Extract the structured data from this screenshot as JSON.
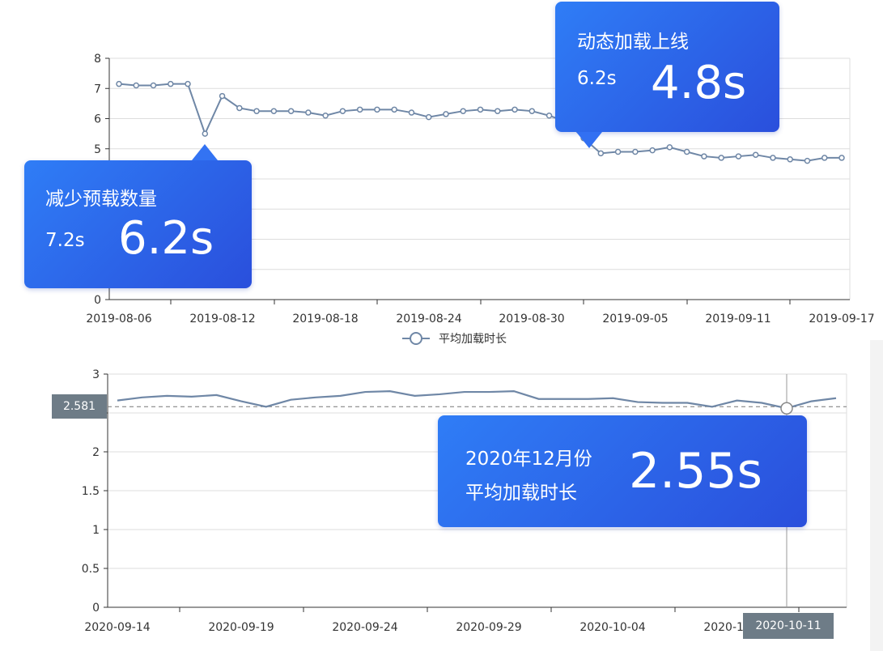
{
  "colors": {
    "line": "#6f87a6",
    "callout": "#2f6cf0",
    "grid": "#dddddd",
    "axis": "#333333"
  },
  "chart_data": [
    {
      "type": "line",
      "title": "",
      "xlabel": "",
      "ylabel": "",
      "ylim": [
        0,
        8
      ],
      "yticks": [
        0,
        1,
        2,
        3,
        4,
        5,
        6,
        7,
        8
      ],
      "xtick_labels": [
        "2019-08-06",
        "2019-08-12",
        "2019-08-18",
        "2019-08-24",
        "2019-08-30",
        "2019-09-05",
        "2019-09-11",
        "2019-09-17"
      ],
      "grid": true,
      "legend": "bottom",
      "series": [
        {
          "name": "平均加载时长",
          "x": [
            "2019-08-06",
            "2019-08-07",
            "2019-08-08",
            "2019-08-09",
            "2019-08-10",
            "2019-08-11",
            "2019-08-12",
            "2019-08-13",
            "2019-08-14",
            "2019-08-15",
            "2019-08-16",
            "2019-08-17",
            "2019-08-18",
            "2019-08-19",
            "2019-08-20",
            "2019-08-21",
            "2019-08-22",
            "2019-08-23",
            "2019-08-24",
            "2019-08-25",
            "2019-08-26",
            "2019-08-27",
            "2019-08-28",
            "2019-08-29",
            "2019-08-30",
            "2019-08-31",
            "2019-09-01",
            "2019-09-02",
            "2019-09-03",
            "2019-09-04",
            "2019-09-05",
            "2019-09-06",
            "2019-09-07",
            "2019-09-08",
            "2019-09-09",
            "2019-09-10",
            "2019-09-11",
            "2019-09-12",
            "2019-09-13",
            "2019-09-14",
            "2019-09-15",
            "2019-09-16",
            "2019-09-17"
          ],
          "values": [
            7.15,
            7.1,
            7.1,
            7.15,
            7.15,
            5.5,
            6.75,
            6.35,
            6.25,
            6.25,
            6.25,
            6.2,
            6.1,
            6.25,
            6.3,
            6.3,
            6.3,
            6.2,
            6.05,
            6.15,
            6.25,
            6.3,
            6.25,
            6.3,
            6.25,
            6.1,
            5.9,
            5.35,
            4.85,
            4.9,
            4.9,
            4.95,
            5.05,
            4.9,
            4.75,
            4.7,
            4.75,
            4.8,
            4.7,
            4.65,
            4.6,
            4.7,
            4.7
          ]
        }
      ],
      "annotations": [
        {
          "title": "减少预载数量",
          "before": "7.2s",
          "after": "6.2s",
          "at": "2019-08-11"
        },
        {
          "title": "动态加载上线",
          "before": "6.2s",
          "after": "4.8s",
          "at": "2019-09-03"
        }
      ]
    },
    {
      "type": "line",
      "title": "",
      "xlabel": "",
      "ylabel": "",
      "ylim": [
        0,
        3
      ],
      "yticks": [
        0,
        0.5,
        1,
        1.5,
        2,
        2.5,
        3
      ],
      "xtick_labels": [
        "2020-09-14",
        "2020-09-19",
        "2020-09-24",
        "2020-09-29",
        "2020-10-04",
        "2020-10-09"
      ],
      "grid": true,
      "series": [
        {
          "values": [
            2.66,
            2.7,
            2.72,
            2.71,
            2.73,
            2.65,
            2.58,
            2.67,
            2.7,
            2.72,
            2.77,
            2.78,
            2.72,
            2.74,
            2.77,
            2.77,
            2.78,
            2.68,
            2.68,
            2.68,
            2.69,
            2.64,
            2.63,
            2.63,
            2.58,
            2.66,
            2.63,
            2.56,
            2.65,
            2.69
          ]
        }
      ],
      "crosshair": {
        "y_value": "2.581",
        "x_value": "2020-10-11"
      },
      "annotation": {
        "line1": "2020年12月份",
        "line2": "平均加载时长",
        "value": "2.55s"
      }
    }
  ]
}
